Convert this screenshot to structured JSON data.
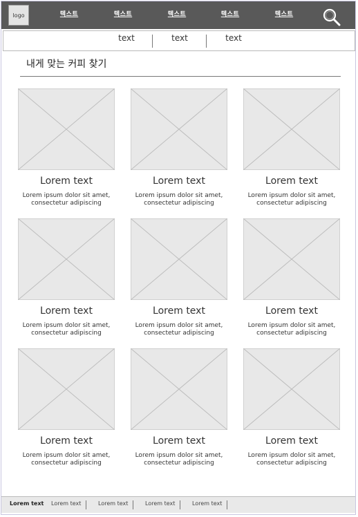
{
  "header": {
    "logo_label": "logo",
    "nav_items": [
      "텍스트",
      "텍스트",
      "텍스트",
      "텍스트",
      "텍스트"
    ],
    "search_icon": "search-icon"
  },
  "subnav": {
    "items": [
      "text",
      "text",
      "text"
    ]
  },
  "main": {
    "page_title": "내게 맞는 커피 찾기",
    "cards": [
      {
        "title": "Lorem text",
        "desc_line1": "Lorem ipsum dolor sit amet,",
        "desc_line2": "consectetur adipiscing"
      },
      {
        "title": "Lorem text",
        "desc_line1": "Lorem ipsum dolor sit amet,",
        "desc_line2": "consectetur adipiscing"
      },
      {
        "title": "Lorem text",
        "desc_line1": "Lorem ipsum dolor sit amet,",
        "desc_line2": "consectetur adipiscing"
      },
      {
        "title": "Lorem text",
        "desc_line1": "Lorem ipsum dolor sit amet,",
        "desc_line2": "consectetur adipiscing"
      },
      {
        "title": "Lorem text",
        "desc_line1": "Lorem ipsum dolor sit amet,",
        "desc_line2": "consectetur adipiscing"
      },
      {
        "title": "Lorem text",
        "desc_line1": "Lorem ipsum dolor sit amet,",
        "desc_line2": "consectetur adipiscing"
      },
      {
        "title": "Lorem text",
        "desc_line1": "Lorem ipsum dolor sit amet,",
        "desc_line2": "consectetur adipiscing"
      },
      {
        "title": "Lorem text",
        "desc_line1": "Lorem ipsum dolor sit amet,",
        "desc_line2": "consectetur adipiscing"
      },
      {
        "title": "Lorem text",
        "desc_line1": "Lorem ipsum dolor sit amet,",
        "desc_line2": "consectetur adipiscing"
      }
    ]
  },
  "footer": {
    "items": [
      "Lorem text",
      "Lorem text",
      "Lorem text",
      "Lorem text",
      "Lorem text"
    ]
  },
  "colors": {
    "topbar": "#595959",
    "placeholder": "#e8e8e8",
    "footer": "#e9e9e9"
  }
}
